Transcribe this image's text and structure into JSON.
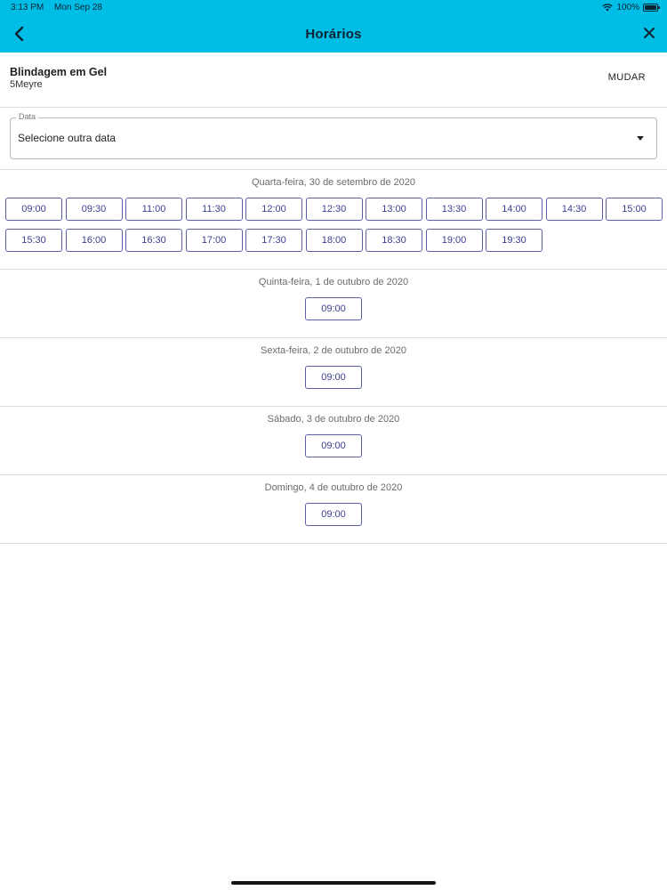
{
  "status_bar": {
    "time": "3:13 PM",
    "date": "Mon Sep 28",
    "battery": "100%"
  },
  "header": {
    "title": "Horários"
  },
  "service": {
    "name": "Blindagem em Gel",
    "provider": "5Meyre",
    "change_label": "MUDAR"
  },
  "date_picker": {
    "label": "Data",
    "value": "Selecione outra data"
  },
  "days": [
    {
      "heading": "Quarta-feira, 30 de setembro de 2020",
      "slots": [
        "09:00",
        "09:30",
        "11:00",
        "11:30",
        "12:00",
        "12:30",
        "13:00",
        "13:30",
        "14:00",
        "14:30",
        "15:00",
        "15:30",
        "16:00",
        "16:30",
        "17:00",
        "17:30",
        "18:00",
        "18:30",
        "19:00",
        "19:30"
      ]
    },
    {
      "heading": "Quinta-feira, 1 de outubro de 2020",
      "slots": [
        "09:00"
      ]
    },
    {
      "heading": "Sexta-feira, 2 de outubro de 2020",
      "slots": [
        "09:00"
      ]
    },
    {
      "heading": "Sábado, 3 de outubro de 2020",
      "slots": [
        "09:00"
      ]
    },
    {
      "heading": "Domingo, 4 de outubro de 2020",
      "slots": [
        "09:00"
      ]
    }
  ]
}
